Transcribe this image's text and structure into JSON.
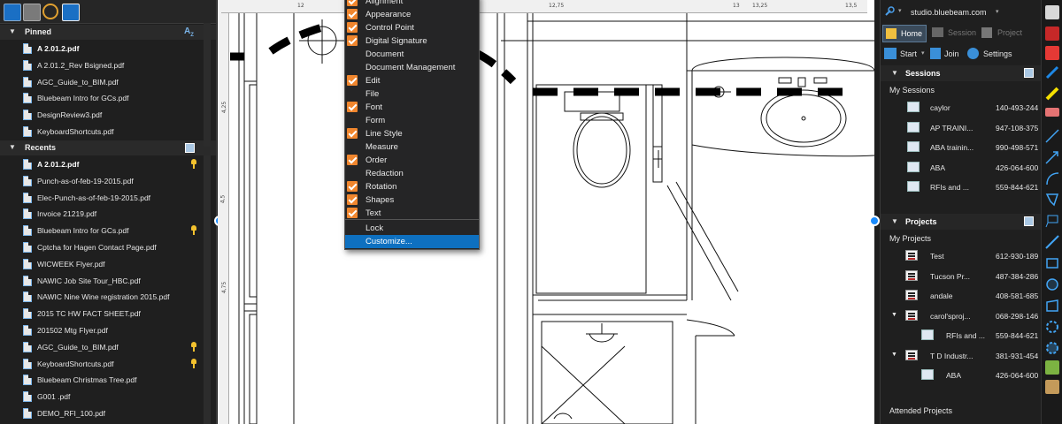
{
  "left_panel": {
    "pinned_title": "Pinned",
    "pinned": [
      {
        "name": "A 2.01.2.pdf",
        "bold": true
      },
      {
        "name": "A 2.01.2_Rev Bsigned.pdf"
      },
      {
        "name": "AGC_Guide_to_BIM.pdf"
      },
      {
        "name": "Bluebeam Intro for GCs.pdf"
      },
      {
        "name": "DesignReview3.pdf"
      },
      {
        "name": "KeyboardShortcuts.pdf"
      }
    ],
    "recents_title": "Recents",
    "recents": [
      {
        "name": "A 2.01.2.pdf",
        "bold": true,
        "pinned": true
      },
      {
        "name": "Punch-as-of-feb-19-2015.pdf"
      },
      {
        "name": "Elec-Punch-as-of-feb-19-2015.pdf"
      },
      {
        "name": "Invoice 21219.pdf"
      },
      {
        "name": "Bluebeam Intro for GCs.pdf",
        "pinned": true
      },
      {
        "name": "Cptcha for Hagen Contact Page.pdf"
      },
      {
        "name": "WICWEEK Flyer.pdf"
      },
      {
        "name": "NAWIC Job Site Tour_HBC.pdf"
      },
      {
        "name": "NAWIC Nine Wine registration 2015.pdf"
      },
      {
        "name": "2015 TC HW FACT SHEET.pdf"
      },
      {
        "name": "201502 Mtg Flyer.pdf"
      },
      {
        "name": "AGC_Guide_to_BIM.pdf",
        "pinned": true
      },
      {
        "name": "KeyboardShortcuts.pdf",
        "pinned": true
      },
      {
        "name": "Bluebeam Christmas Tree.pdf"
      },
      {
        "name": "G001 .pdf"
      },
      {
        "name": "DEMO_RFI_100.pdf"
      }
    ]
  },
  "ruler": {
    "top_ticks": [
      "12",
      "12,75",
      "13",
      "13,25",
      "13,5"
    ],
    "left_ticks": [
      "4,25",
      "4,5",
      "4,75"
    ]
  },
  "menu": {
    "items": [
      {
        "label": "Alignment",
        "checked": true
      },
      {
        "label": "Appearance",
        "checked": true
      },
      {
        "label": "Control Point",
        "checked": true
      },
      {
        "label": "Digital Signature",
        "checked": true
      },
      {
        "label": "Document",
        "checked": false
      },
      {
        "label": "Document Management",
        "checked": false
      },
      {
        "label": "Edit",
        "checked": true
      },
      {
        "label": "File",
        "checked": false
      },
      {
        "label": "Font",
        "checked": true
      },
      {
        "label": "Form",
        "checked": false
      },
      {
        "label": "Line Style",
        "checked": true
      },
      {
        "label": "Measure",
        "checked": false
      },
      {
        "label": "Order",
        "checked": true
      },
      {
        "label": "Redaction",
        "checked": false
      },
      {
        "label": "Rotation",
        "checked": true
      },
      {
        "label": "Shapes",
        "checked": true
      },
      {
        "label": "Text",
        "checked": true
      }
    ],
    "lock_label": "Lock",
    "customize_label": "Customize..."
  },
  "studio": {
    "server": "studio.bluebeam.com",
    "tabs": {
      "home": "Home",
      "session": "Session",
      "project": "Project"
    },
    "actions": {
      "start": "Start",
      "join": "Join",
      "settings": "Settings"
    },
    "sessions_title": "Sessions",
    "my_sessions": "My Sessions",
    "sessions": [
      {
        "name": "caylor",
        "id": "140-493-244"
      },
      {
        "name": "AP TRAINI...",
        "id": "947-108-375"
      },
      {
        "name": "ABA trainin...",
        "id": "990-498-571"
      },
      {
        "name": "ABA",
        "id": "426-064-600"
      },
      {
        "name": "RFIs and ...",
        "id": "559-844-621"
      }
    ],
    "projects_title": "Projects",
    "my_projects": "My Projects",
    "projects": [
      {
        "name": "Test",
        "id": "612-930-189",
        "indent": 0,
        "type": "project"
      },
      {
        "name": "Tucson Pr...",
        "id": "487-384-286",
        "indent": 0,
        "type": "project"
      },
      {
        "name": "andale",
        "id": "408-581-685",
        "indent": 0,
        "type": "project"
      },
      {
        "name": "carol'sproj...",
        "id": "068-298-146",
        "indent": 0,
        "type": "project",
        "expanded": true
      },
      {
        "name": "RFIs and ...",
        "id": "559-844-621",
        "indent": 1,
        "type": "session"
      },
      {
        "name": "T D Industr...",
        "id": "381-931-454",
        "indent": 0,
        "type": "project",
        "expanded": true
      },
      {
        "name": "ABA",
        "id": "426-064-600",
        "indent": 1,
        "type": "session"
      }
    ],
    "attended_projects": "Attended Projects"
  },
  "colors": {
    "accent": "#1a8cff",
    "menu_check": "#f0862e",
    "menu_highlight": "#0e70c0",
    "pin": "#f2c12e"
  }
}
